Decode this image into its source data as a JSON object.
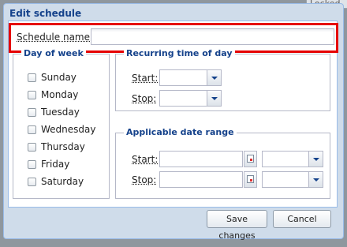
{
  "background": {
    "tab_label": "Locked"
  },
  "dialog": {
    "title": "Edit schedule",
    "schedule_name_label": "Schedule name:",
    "schedule_name_value": ""
  },
  "day_of_week": {
    "legend": "Day of week",
    "days": [
      "Sunday",
      "Monday",
      "Tuesday",
      "Wednesday",
      "Thursday",
      "Friday",
      "Saturday"
    ]
  },
  "recurring": {
    "legend": "Recurring time of day",
    "start_label": "Start:",
    "stop_label": "Stop:"
  },
  "date_range": {
    "legend": "Applicable date range",
    "start_label": "Start:",
    "stop_label": "Stop:"
  },
  "buttons": {
    "save": "Save changes",
    "cancel": "Cancel"
  },
  "colors": {
    "highlight": "#e60000",
    "title_text": "#15428b",
    "dialog_bg": "#cfdcea"
  }
}
